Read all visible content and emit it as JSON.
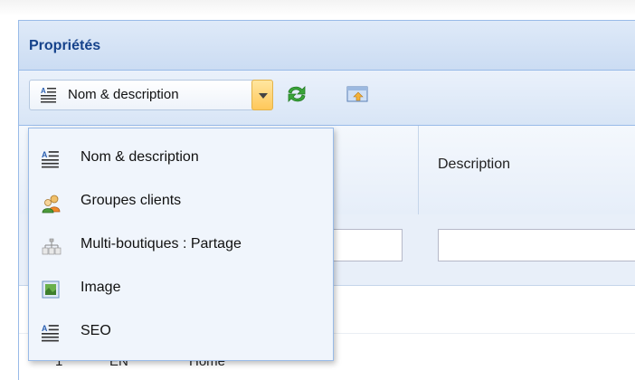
{
  "panel": {
    "title": "Propriétés"
  },
  "toolbar": {
    "combo": {
      "selected_label": "Nom & description",
      "icon": "text-lines-icon"
    },
    "refresh_icon": "refresh-icon",
    "export_icon": "export-icon"
  },
  "grid": {
    "columns": [
      "Description"
    ],
    "rows": [
      {
        "id": "1",
        "lang": "EN",
        "name": "Home"
      }
    ]
  },
  "menu": {
    "items": [
      {
        "label": "Nom & description",
        "icon": "text-lines-icon"
      },
      {
        "label": "Groupes clients",
        "icon": "users-icon"
      },
      {
        "label": "Multi-boutiques : Partage",
        "icon": "shops-icon"
      },
      {
        "label": "Image",
        "icon": "image-icon"
      },
      {
        "label": "SEO",
        "icon": "text-lines-icon"
      }
    ]
  }
}
